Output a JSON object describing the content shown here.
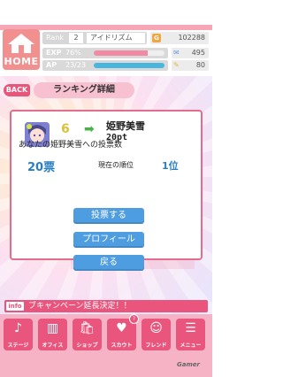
{
  "header": {
    "home_label": "HOME",
    "rank_label": "Rank",
    "rank_value": "2",
    "rank_title": "アイドリズム",
    "coin_icon": "coin-icon",
    "coin_value": "102288",
    "exp_label": "EXP",
    "exp_percent_text": "76%",
    "exp_fill": 0.76,
    "ap_label": "AP",
    "ap_text": "23/23",
    "ap_fill": 1.0,
    "currency1_value": "495",
    "currency2_value": "80"
  },
  "title_bar": {
    "back_label": "BACK",
    "title": "ランキング詳細"
  },
  "card": {
    "prev_rank": "6",
    "arrow": "➡",
    "name": "姫野美雪",
    "points": "20pt",
    "vote_label": "あなたの姫野美雪への投票数",
    "votes": "20票",
    "current_rank_label": "現在の順位",
    "current_rank": "1位",
    "buttons": {
      "vote": "投票する",
      "profile": "プロフィール",
      "back": "戻る"
    }
  },
  "info": {
    "tag": "info",
    "text": "ブキャンペーン延長決定！！"
  },
  "bottom_nav": [
    {
      "label": "ステージ",
      "icon": "stage-icon",
      "glyph": "♪"
    },
    {
      "label": "オフィス",
      "icon": "office-icon",
      "glyph": "▥"
    },
    {
      "label": "ショップ",
      "icon": "shop-icon",
      "glyph": "🛍"
    },
    {
      "label": "スカウト",
      "icon": "scout-icon",
      "glyph": "♥",
      "badge": "?"
    },
    {
      "label": "フレンド",
      "icon": "friend-icon",
      "glyph": "☺"
    },
    {
      "label": "メニュー",
      "icon": "menu-icon",
      "glyph": "☰"
    }
  ],
  "watermark": "Gamer",
  "colors": {
    "accent_pink": "#e9557c",
    "button_blue": "#4e9de0",
    "value_blue": "#2a7fc4"
  }
}
